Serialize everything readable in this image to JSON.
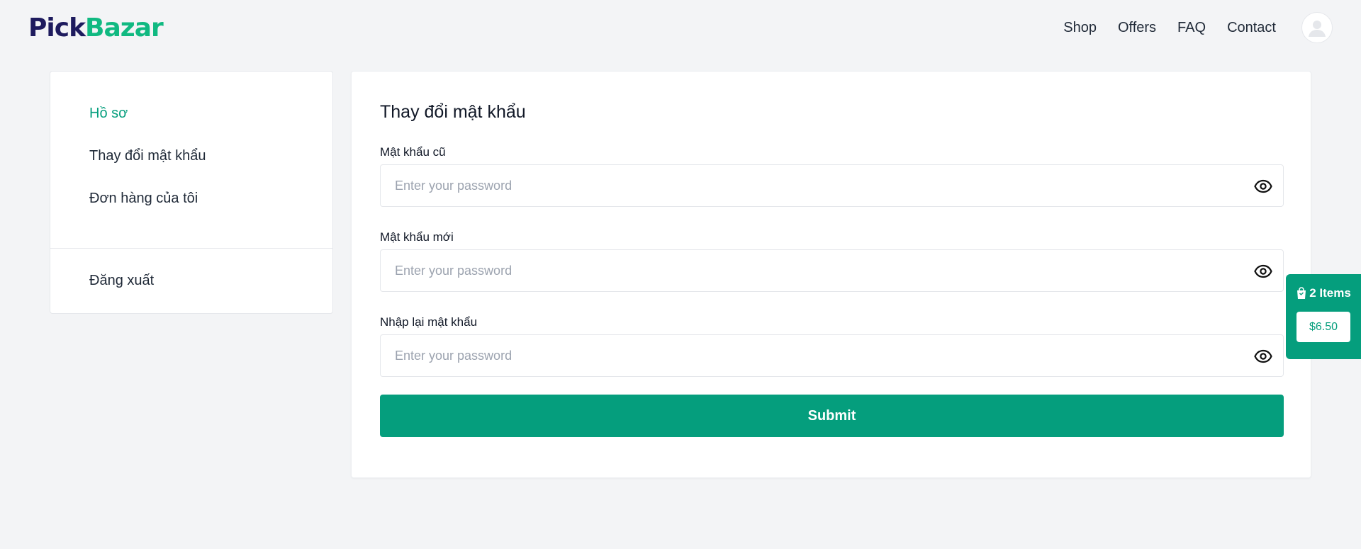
{
  "header": {
    "logo_part1": "Pick",
    "logo_part2": "Bazar",
    "nav": [
      "Shop",
      "Offers",
      "FAQ",
      "Contact"
    ],
    "avatar_icon": "user-avatar-icon"
  },
  "sidebar": {
    "items": [
      {
        "label": "Hồ sơ",
        "active": true
      },
      {
        "label": "Thay đổi mật khẩu",
        "active": false
      },
      {
        "label": "Đơn hàng của tôi",
        "active": false
      }
    ],
    "logout": "Đăng xuất"
  },
  "form": {
    "title": "Thay đổi mật khẩu",
    "fields": [
      {
        "label": "Mật khẩu cũ",
        "placeholder": "Enter your password",
        "value": ""
      },
      {
        "label": "Mật khẩu mới",
        "placeholder": "Enter your password",
        "value": ""
      },
      {
        "label": "Nhập lại mật khẩu",
        "placeholder": "Enter your password",
        "value": ""
      }
    ],
    "submit_label": "Submit"
  },
  "cart": {
    "items_label": "2 Items",
    "total": "$6.50",
    "icon": "shopping-bag-icon"
  },
  "colors": {
    "accent": "#059e7d",
    "logo_dark": "#1e1b5e",
    "logo_green": "#10b981",
    "background": "#f3f4f6"
  }
}
